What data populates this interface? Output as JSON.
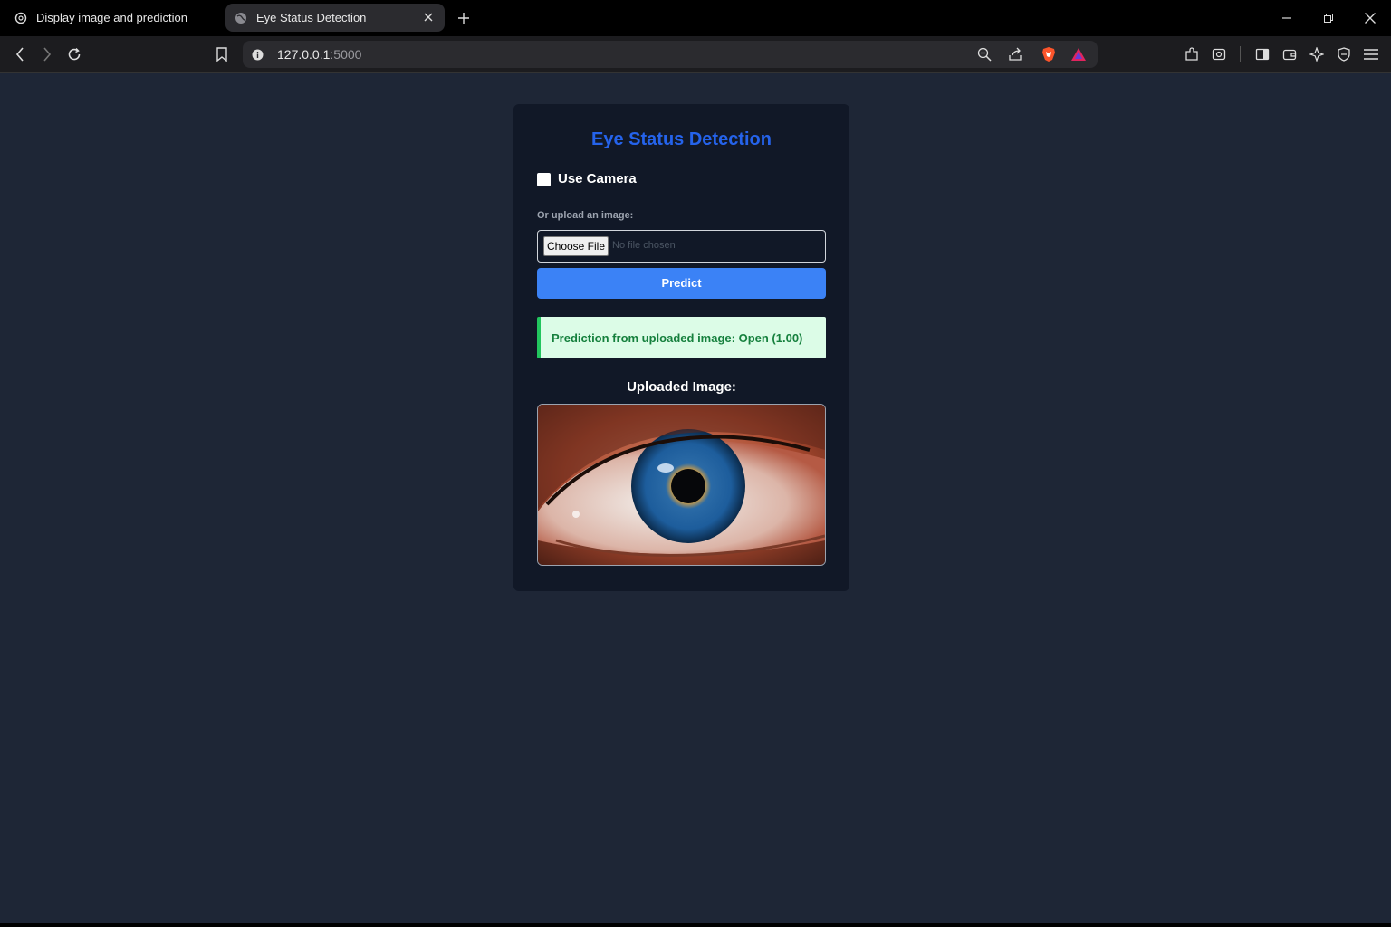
{
  "browser": {
    "tabs": [
      {
        "label": "Display image and prediction",
        "icon": "openai-icon"
      },
      {
        "label": "Eye Status Detection",
        "icon": "globe-icon"
      }
    ],
    "url_host": "127.0.0.1",
    "url_port": ":5000"
  },
  "page": {
    "title": "Eye Status Detection",
    "camera_label": "Use Camera",
    "upload_label": "Or upload an image:",
    "choose_file": "Choose File",
    "no_file": "No file chosen",
    "predict_label": "Predict",
    "result_text": "Prediction from uploaded image: Open (1.00)",
    "image_heading": "Uploaded Image:",
    "colors": {
      "background": "#1e2636",
      "card": "#111827",
      "title": "#2563eb",
      "predict": "#3b82f6",
      "result_bg": "#dcfce7",
      "result_text": "#15803d"
    }
  }
}
